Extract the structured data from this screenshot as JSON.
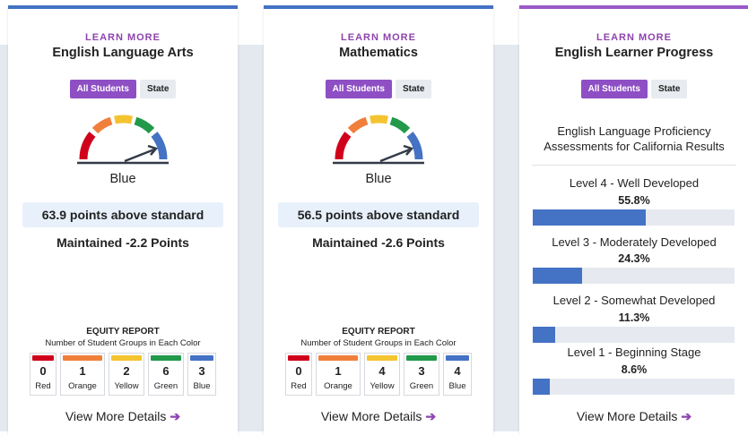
{
  "colors": {
    "accent_purple": "#8e44ad",
    "blue": "#4472c4",
    "red": "#d0021b",
    "orange": "#f07f3c",
    "yellow": "#f4c430",
    "green": "#22994a"
  },
  "cards": [
    {
      "learn_more": "LEARN MORE",
      "title": "English Language Arts",
      "toggle": {
        "all": "All Students",
        "state": "State"
      },
      "gauge_color": "Blue",
      "gauge_icon": "performance-gauge-icon",
      "status": "63.9 points above standard",
      "change": "Maintained -2.2 Points",
      "equity": {
        "title": "EQUITY REPORT",
        "subtitle": "Number of Student Groups in Each Color",
        "items": [
          {
            "count": "0",
            "label": "Red",
            "color": "#d0021b"
          },
          {
            "count": "1",
            "label": "Orange",
            "color": "#f07f3c"
          },
          {
            "count": "2",
            "label": "Yellow",
            "color": "#f4c430"
          },
          {
            "count": "6",
            "label": "Green",
            "color": "#22994a"
          },
          {
            "count": "3",
            "label": "Blue",
            "color": "#4472c4"
          }
        ]
      },
      "details": "View More Details"
    },
    {
      "learn_more": "LEARN MORE",
      "title": "Mathematics",
      "toggle": {
        "all": "All Students",
        "state": "State"
      },
      "gauge_color": "Blue",
      "gauge_icon": "performance-gauge-icon",
      "status": "56.5 points above standard",
      "change": "Maintained -2.6 Points",
      "equity": {
        "title": "EQUITY REPORT",
        "subtitle": "Number of Student Groups in Each Color",
        "items": [
          {
            "count": "0",
            "label": "Red",
            "color": "#d0021b"
          },
          {
            "count": "1",
            "label": "Orange",
            "color": "#f07f3c"
          },
          {
            "count": "4",
            "label": "Yellow",
            "color": "#f4c430"
          },
          {
            "count": "3",
            "label": "Green",
            "color": "#22994a"
          },
          {
            "count": "4",
            "label": "Blue",
            "color": "#4472c4"
          }
        ]
      },
      "details": "View More Details"
    },
    {
      "learn_more": "LEARN MORE",
      "title": "English Learner Progress",
      "toggle": {
        "all": "All Students",
        "state": "State"
      },
      "assessment_line1": "English Language Proficiency",
      "assessment_line2": "Assessments for California Results",
      "levels": [
        {
          "label": "Level 4 - Well Developed",
          "pct_text": "55.8%",
          "pct": 55.8
        },
        {
          "label": "Level 3 - Moderately Developed",
          "pct_text": "24.3%",
          "pct": 24.3
        },
        {
          "label": "Level 2 - Somewhat Developed",
          "pct_text": "11.3%",
          "pct": 11.3
        },
        {
          "label": "Level 1 - Beginning Stage",
          "pct_text": "8.6%",
          "pct": 8.6
        }
      ],
      "details": "View More Details"
    }
  ]
}
